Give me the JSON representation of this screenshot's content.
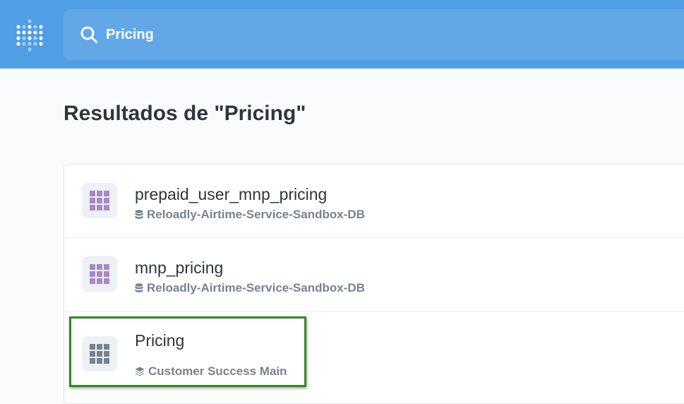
{
  "search": {
    "value": "Pricing"
  },
  "page": {
    "title": "Resultados de \"Pricing\""
  },
  "results": [
    {
      "title": "prepaid_user_mnp_pricing",
      "subtitle": "Reloadly-Airtime-Service-Sandbox-DB",
      "icon": "table-grid-icon",
      "subtitle_icon": "database-icon"
    },
    {
      "title": "mnp_pricing",
      "subtitle": "Reloadly-Airtime-Service-Sandbox-DB",
      "icon": "table-grid-icon",
      "subtitle_icon": "database-icon"
    },
    {
      "title": "Pricing",
      "subtitle": "Customer Success Main",
      "icon": "table-grid-icon",
      "subtitle_icon": "layers-icon",
      "highlighted": true
    }
  ],
  "colors": {
    "topbar": "#509ee3",
    "search_bg": "#62a7e6",
    "table_icon": "#a989c5",
    "table_icon_gray": "#74838f",
    "highlight_border": "#2e8b1e",
    "text_dark": "#2e353b",
    "text_muted": "#76838f"
  }
}
